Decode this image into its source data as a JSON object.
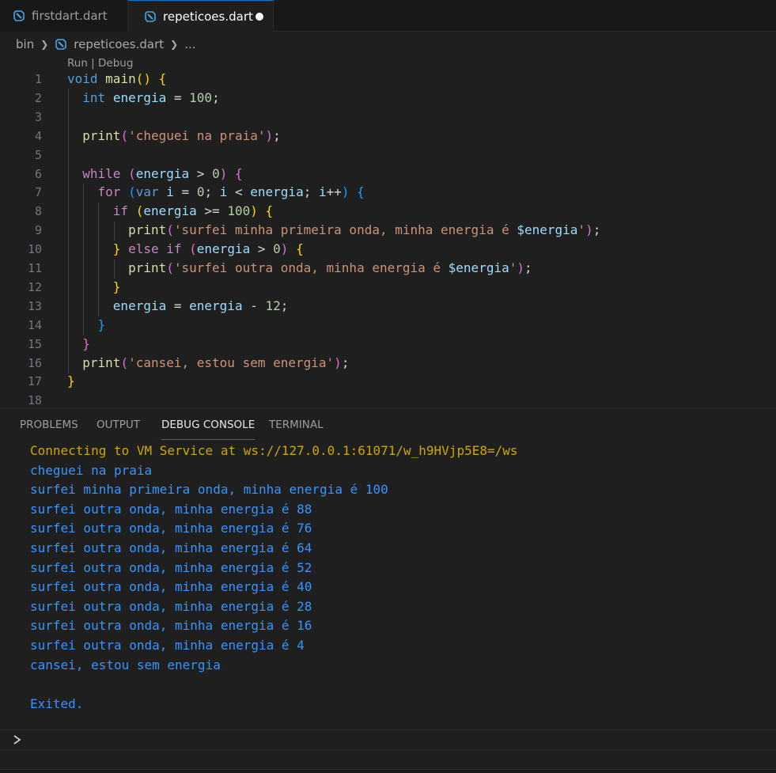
{
  "tabs": [
    {
      "label": "firstdart.dart"
    },
    {
      "label": "repeticoes.dart"
    }
  ],
  "breadcrumb": {
    "folder": "bin",
    "file": "repeticoes.dart",
    "more": "..."
  },
  "codelens": {
    "run": "Run",
    "sep": " | ",
    "debug": "Debug"
  },
  "code": {
    "line_numbers": [
      "1",
      "2",
      "3",
      "4",
      "5",
      "6",
      "7",
      "8",
      "9",
      "10",
      "11",
      "12",
      "13",
      "14",
      "15",
      "16",
      "17",
      "18"
    ],
    "lines": [
      [
        [
          "kw",
          "void"
        ],
        [
          "pl",
          " "
        ],
        [
          "fn",
          "main"
        ],
        [
          "br1",
          "()"
        ],
        [
          "pl",
          " "
        ],
        [
          "br1",
          "{"
        ]
      ],
      [
        [
          "pl",
          "  "
        ],
        [
          "kw",
          "int"
        ],
        [
          "pl",
          " "
        ],
        [
          "var",
          "energia"
        ],
        [
          "pl",
          " = "
        ],
        [
          "num",
          "100"
        ],
        [
          "pl",
          ";"
        ]
      ],
      [],
      [
        [
          "pl",
          "  "
        ],
        [
          "fn",
          "print"
        ],
        [
          "br2",
          "("
        ],
        [
          "str",
          "'cheguei na praia'"
        ],
        [
          "br2",
          ")"
        ],
        [
          "pl",
          ";"
        ]
      ],
      [],
      [
        [
          "pl",
          "  "
        ],
        [
          "ctl",
          "while"
        ],
        [
          "pl",
          " "
        ],
        [
          "br2",
          "("
        ],
        [
          "var",
          "energia"
        ],
        [
          "pl",
          " > "
        ],
        [
          "num",
          "0"
        ],
        [
          "br2",
          ")"
        ],
        [
          "pl",
          " "
        ],
        [
          "br2",
          "{"
        ]
      ],
      [
        [
          "pl",
          "    "
        ],
        [
          "ctl",
          "for"
        ],
        [
          "pl",
          " "
        ],
        [
          "br3",
          "("
        ],
        [
          "kw",
          "var"
        ],
        [
          "pl",
          " "
        ],
        [
          "var",
          "i"
        ],
        [
          "pl",
          " = "
        ],
        [
          "num",
          "0"
        ],
        [
          "pl",
          "; "
        ],
        [
          "var",
          "i"
        ],
        [
          "pl",
          " < "
        ],
        [
          "var",
          "energia"
        ],
        [
          "pl",
          "; "
        ],
        [
          "var",
          "i"
        ],
        [
          "pl",
          "++"
        ],
        [
          "br3",
          ")"
        ],
        [
          "pl",
          " "
        ],
        [
          "br3",
          "{"
        ]
      ],
      [
        [
          "pl",
          "      "
        ],
        [
          "ctl",
          "if"
        ],
        [
          "pl",
          " "
        ],
        [
          "br1",
          "("
        ],
        [
          "var",
          "energia"
        ],
        [
          "pl",
          " >= "
        ],
        [
          "num",
          "100"
        ],
        [
          "br1",
          ")"
        ],
        [
          "pl",
          " "
        ],
        [
          "br1",
          "{"
        ]
      ],
      [
        [
          "pl",
          "        "
        ],
        [
          "fn",
          "print"
        ],
        [
          "br2",
          "("
        ],
        [
          "str",
          "'surfei minha primeira onda, minha energia é "
        ],
        [
          "var",
          "$energia"
        ],
        [
          "str",
          "'"
        ],
        [
          "br2",
          ")"
        ],
        [
          "pl",
          ";"
        ]
      ],
      [
        [
          "pl",
          "      "
        ],
        [
          "br1",
          "}"
        ],
        [
          "pl",
          " "
        ],
        [
          "ctl",
          "else if"
        ],
        [
          "pl",
          " "
        ],
        [
          "br2",
          "("
        ],
        [
          "var",
          "energia"
        ],
        [
          "pl",
          " > "
        ],
        [
          "num",
          "0"
        ],
        [
          "br2",
          ")"
        ],
        [
          "pl",
          " "
        ],
        [
          "br1",
          "{"
        ]
      ],
      [
        [
          "pl",
          "        "
        ],
        [
          "fn",
          "print"
        ],
        [
          "br2",
          "("
        ],
        [
          "str",
          "'surfei outra onda, minha energia é "
        ],
        [
          "var",
          "$energia"
        ],
        [
          "str",
          "'"
        ],
        [
          "br2",
          ")"
        ],
        [
          "pl",
          ";"
        ]
      ],
      [
        [
          "pl",
          "      "
        ],
        [
          "br1",
          "}"
        ]
      ],
      [
        [
          "pl",
          "      "
        ],
        [
          "var",
          "energia"
        ],
        [
          "pl",
          " = "
        ],
        [
          "var",
          "energia"
        ],
        [
          "pl",
          " - "
        ],
        [
          "num",
          "12"
        ],
        [
          "pl",
          ";"
        ]
      ],
      [
        [
          "pl",
          "    "
        ],
        [
          "br3",
          "}"
        ]
      ],
      [
        [
          "pl",
          "  "
        ],
        [
          "br2",
          "}"
        ]
      ],
      [
        [
          "pl",
          "  "
        ],
        [
          "fn",
          "print"
        ],
        [
          "br2",
          "("
        ],
        [
          "str",
          "'cansei, estou sem energia'"
        ],
        [
          "br2",
          ")"
        ],
        [
          "pl",
          ";"
        ]
      ],
      [
        [
          "br1",
          "}"
        ]
      ],
      []
    ]
  },
  "panel": {
    "tabs": [
      "PROBLEMS",
      "OUTPUT",
      "DEBUG CONSOLE",
      "TERMINAL"
    ],
    "active_tab": "DEBUG CONSOLE",
    "console_lines": [
      "Connecting to VM Service at ws://127.0.0.1:61071/w_h9HVjp5E8=/ws",
      "cheguei na praia",
      "surfei minha primeira onda, minha energia é 100",
      "surfei outra onda, minha energia é 88",
      "surfei outra onda, minha energia é 76",
      "surfei outra onda, minha energia é 64",
      "surfei outra onda, minha energia é 52",
      "surfei outra onda, minha energia é 40",
      "surfei outra onda, minha energia é 28",
      "surfei outra onda, minha energia é 16",
      "surfei outra onda, minha energia é 4",
      "cansei, estou sem energia",
      "",
      "Exited."
    ]
  },
  "colors": {
    "accent": "#0078d4",
    "console_text": "#3794ff",
    "console_warning": "#cca700"
  }
}
